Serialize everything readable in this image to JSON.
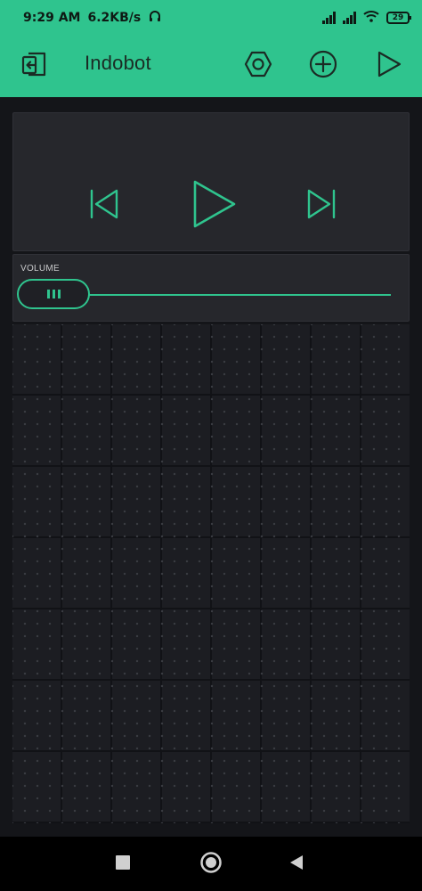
{
  "status_bar": {
    "time": "9:29 AM",
    "data_speed": "6.2KB/s",
    "battery": "29"
  },
  "app_bar": {
    "title": "Indobot",
    "icons": [
      "exit-icon",
      "hexagon-settings-icon",
      "add-circle-icon",
      "play-icon"
    ]
  },
  "player": {
    "icons": [
      "skip-previous-icon",
      "play-icon",
      "skip-next-icon"
    ]
  },
  "slider": {
    "label": "VOLUME",
    "value_fraction": 0.0
  },
  "nav_bar": {
    "icons": [
      "recents-square-icon",
      "home-circle-icon",
      "back-triangle-icon"
    ]
  },
  "colors": {
    "accent": "#2fc48e",
    "background": "#141519",
    "widget": "#26272c"
  }
}
